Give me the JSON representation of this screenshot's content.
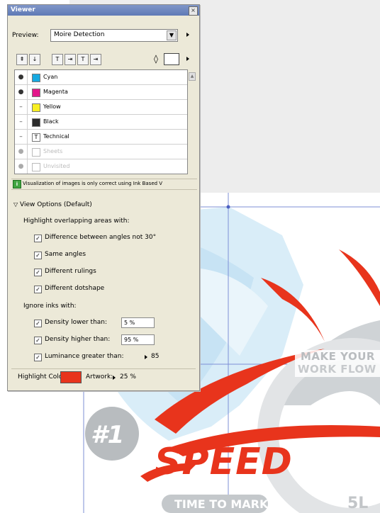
{
  "viewer": {
    "title": "Viewer",
    "close": "×",
    "preview_label": "Preview:",
    "preview_value": "Moire Detection",
    "toolbar": {
      "buttons": [
        "⇞",
        "↓",
        "T",
        "⇥",
        "T",
        "⇥"
      ],
      "diamond": "◊"
    },
    "inks": [
      {
        "name": "Cyan",
        "color": "#16a9e1",
        "visible": true,
        "eye": "●"
      },
      {
        "name": "Magenta",
        "color": "#e3178a",
        "visible": true,
        "eye": "●"
      },
      {
        "name": "Yellow",
        "color": "#f8ef23",
        "visible": false,
        "eye": "–"
      },
      {
        "name": "Black",
        "color": "#2b2b2b",
        "visible": false,
        "eye": "–"
      },
      {
        "name": "Technical",
        "color": "#6b6b6b",
        "visible": false,
        "eye": "–"
      },
      {
        "name": "Sheets",
        "color": "#ffffff",
        "visible": false,
        "eye": "●"
      },
      {
        "name": "Unvisited",
        "color": "#ffffff",
        "visible": false,
        "eye": "●"
      }
    ],
    "info_text": "Visualization of images is only correct using Ink Based V",
    "view_options": "View Options (Default)",
    "highlight_label": "Highlight overlapping areas with:",
    "highlight_options": [
      {
        "label": "Difference between angles not 30°",
        "checked": true
      },
      {
        "label": "Same angles",
        "checked": true
      },
      {
        "label": "Different rulings",
        "checked": true
      },
      {
        "label": "Different dotshape",
        "checked": true
      }
    ],
    "ignore_label": "Ignore inks with:",
    "ignore_options": [
      {
        "label": "Density lower than:",
        "checked": true,
        "value": "5 %"
      },
      {
        "label": "Density higher than:",
        "checked": true,
        "value": "95 %"
      },
      {
        "label": "Luminance greater than:",
        "checked": true,
        "value": "85"
      }
    ],
    "highlight_color_label": "Highlight Color:",
    "highlight_color": "#e8341c",
    "artwork_label": "Artwork:",
    "artwork_value": "25 %"
  },
  "artwork": {
    "make_your": "MAKE YOUR",
    "work_flow": "WORK FLOW",
    "rank": "#1",
    "speed": "SPEED",
    "tagline": "TIME TO MARKET",
    "size": "5L",
    "accent": "#e8341c"
  }
}
